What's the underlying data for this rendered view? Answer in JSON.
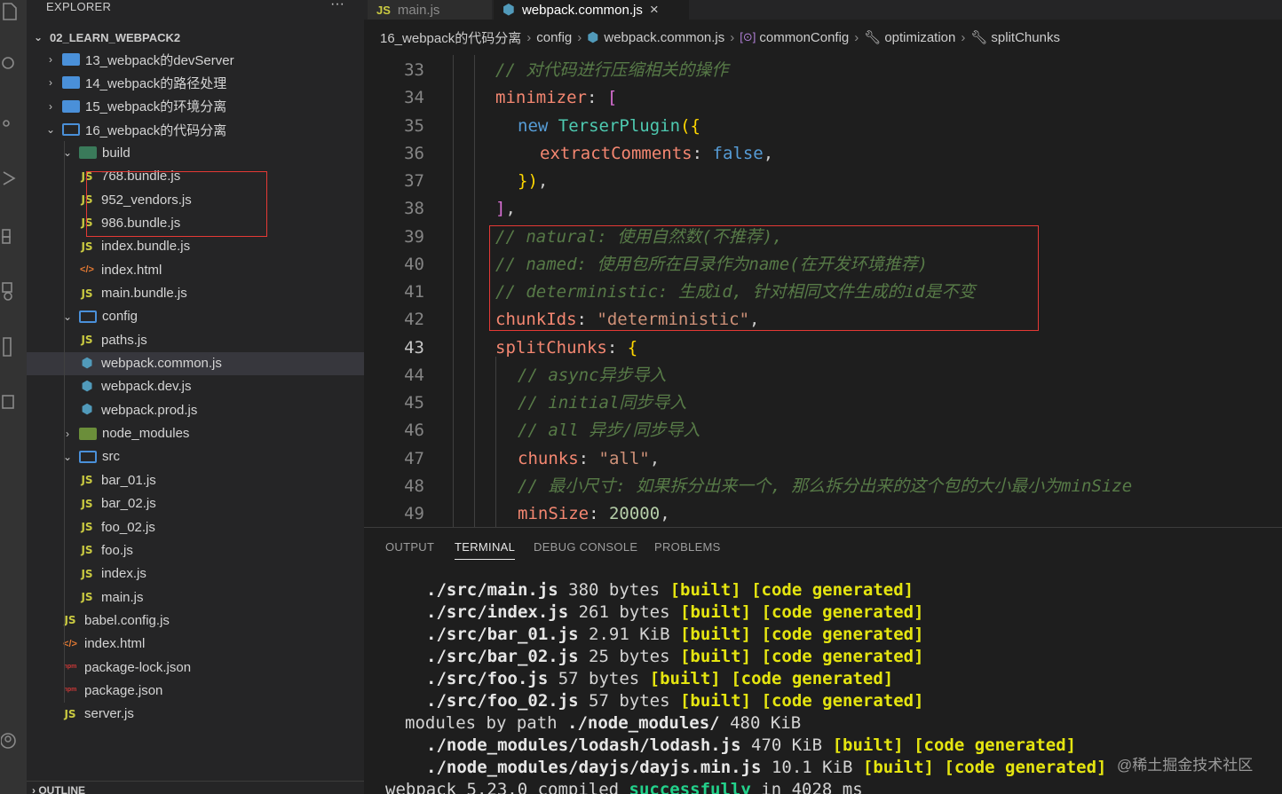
{
  "explorer": {
    "title": "EXPLORER",
    "more": "···",
    "project": "02_LEARN_WEBPACK2",
    "outline": "OUTLINE"
  },
  "tree": [
    {
      "label": "13_webpack的devServer",
      "type": "folder"
    },
    {
      "label": "14_webpack的路径处理",
      "type": "folder"
    },
    {
      "label": "15_webpack的环境分离",
      "type": "folder"
    },
    {
      "label": "16_webpack的代码分离",
      "type": "folder"
    },
    {
      "label": "build",
      "type": "folder"
    },
    {
      "label": "768.bundle.js",
      "type": "js"
    },
    {
      "label": "952_vendors.js",
      "type": "js"
    },
    {
      "label": "986.bundle.js",
      "type": "js"
    },
    {
      "label": "index.bundle.js",
      "type": "js"
    },
    {
      "label": "index.html",
      "type": "html"
    },
    {
      "label": "main.bundle.js",
      "type": "js"
    },
    {
      "label": "config",
      "type": "folder"
    },
    {
      "label": "paths.js",
      "type": "js"
    },
    {
      "label": "webpack.common.js",
      "type": "webpack"
    },
    {
      "label": "webpack.dev.js",
      "type": "webpack"
    },
    {
      "label": "webpack.prod.js",
      "type": "webpack"
    },
    {
      "label": "node_modules",
      "type": "folder"
    },
    {
      "label": "src",
      "type": "folder"
    },
    {
      "label": "bar_01.js",
      "type": "js"
    },
    {
      "label": "bar_02.js",
      "type": "js"
    },
    {
      "label": "foo_02.js",
      "type": "js"
    },
    {
      "label": "foo.js",
      "type": "js"
    },
    {
      "label": "index.js",
      "type": "js"
    },
    {
      "label": "main.js",
      "type": "js"
    },
    {
      "label": "babel.config.js",
      "type": "js"
    },
    {
      "label": "index.html",
      "type": "html"
    },
    {
      "label": "package-lock.json",
      "type": "npm"
    },
    {
      "label": "package.json",
      "type": "npm"
    },
    {
      "label": "server.js",
      "type": "js"
    }
  ],
  "icons": {
    "js": "JS",
    "html": "</>",
    "npm": "npm",
    "webpack": "⬢",
    "chevron_right": "›",
    "chevron_down": "⌄"
  },
  "tabs": [
    {
      "label": "main.js",
      "icon": "JS"
    },
    {
      "label": "webpack.common.js",
      "icon": "⬢",
      "close": "×"
    }
  ],
  "breadcrumb": [
    "16_webpack的代码分离",
    "config",
    "webpack.common.js",
    "commonConfig",
    "optimization",
    "splitChunks"
  ],
  "code": [
    {
      "n": "33",
      "text": "// 对代码进行压缩相关的操作"
    },
    {
      "n": "34",
      "text": "minimizer: ["
    },
    {
      "n": "35",
      "text": "new TerserPlugin({"
    },
    {
      "n": "36",
      "text": "extractComments: false,"
    },
    {
      "n": "37",
      "text": "}),"
    },
    {
      "n": "38",
      "text": "],"
    },
    {
      "n": "39",
      "text": "// natural: 使用自然数(不推荐),"
    },
    {
      "n": "40",
      "text": "// named: 使用包所在目录作为name(在开发环境推荐)"
    },
    {
      "n": "41",
      "text": "// deterministic: 生成id, 针对相同文件生成的id是不变"
    },
    {
      "n": "42",
      "text": "chunkIds: \"deterministic\","
    },
    {
      "n": "43",
      "text": "splitChunks: {"
    },
    {
      "n": "44",
      "text": "// async异步导入"
    },
    {
      "n": "45",
      "text": "// initial同步导入"
    },
    {
      "n": "46",
      "text": "// all 异步/同步导入"
    },
    {
      "n": "47",
      "text": "chunks: \"all\","
    },
    {
      "n": "48",
      "text": "// 最小尺寸: 如果拆分出来一个, 那么拆分出来的这个包的大小最小为minSize"
    },
    {
      "n": "49",
      "text": "minSize: 20000,"
    }
  ],
  "panel_tabs": [
    "OUTPUT",
    "TERMINAL",
    "DEBUG CONSOLE",
    "PROBLEMS"
  ],
  "terminal": [
    {
      "path": "./src/main.js",
      "size": "380 bytes"
    },
    {
      "path": "./src/index.js",
      "size": "261 bytes"
    },
    {
      "path": "./src/bar_01.js",
      "size": "2.91 KiB"
    },
    {
      "path": "./src/bar_02.js",
      "size": "25 bytes"
    },
    {
      "path": "./src/foo.js",
      "size": "57 bytes"
    },
    {
      "path": "./src/foo_02.js",
      "size": "57 bytes"
    },
    {
      "path": "./node_modules/lodash/lodash.js",
      "size": "470 KiB"
    },
    {
      "path": "./node_modules/dayjs/dayjs.min.js",
      "size": "10.1 KiB"
    }
  ],
  "terminal_text": {
    "built": "[built]",
    "generated": "[code generated]",
    "modules_by_path": "modules by path",
    "node_modules_dir": "./node_modules/",
    "node_modules_size": "480 KiB",
    "compile_prefix": "webpack 5.23.0 compiled",
    "compile_status": "successfully",
    "compile_suffix": "in 4028 ms"
  },
  "watermark": "@稀土掘金技术社区",
  "colors": {
    "highlight_box": "#e53935",
    "accent": "#519aba"
  }
}
